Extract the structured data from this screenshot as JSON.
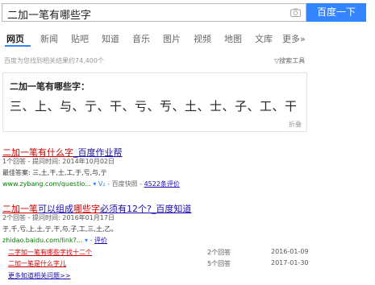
{
  "search": {
    "query": "二加一笔有哪些字",
    "button": "百度一下"
  },
  "tabs": [
    "网页",
    "新闻",
    "贴吧",
    "知道",
    "音乐",
    "图片",
    "视频",
    "地图",
    "文库",
    "更多»"
  ],
  "result_count": "百度为您找到相关结果约74,400个",
  "search_tools": "搜索工具",
  "card": {
    "title": "二加一笔有哪些字：",
    "chars": "三、上、与、亍、干、亏、亐、土、士、子、工、干",
    "collapse": "折叠"
  },
  "result1": {
    "title_hl": "二加一笔有什么字",
    "title_rest": "_百度作业帮",
    "meta": "1个回答 - 提问时间: 2014年10月02日",
    "best": "最佳答案: 三,土,干,士,工,于,亏,与,亍",
    "url": "www.zybang.com/questio...",
    "url_sep": "▾ V₂ -",
    "snapshot": "百度快照",
    "reviews": "4522条评价"
  },
  "result2": {
    "title_a": "二加一笔",
    "title_b": "可以组成",
    "title_c": "哪些字",
    "title_d": "必须有12个?_百度知道",
    "meta": "2个回答 - 提问时间: 2016年01月17日",
    "chars": "于,千,亏,上,土,亍,干,与,子,工,三,土,乙。",
    "url": "zhidao.baidu.com/link?...",
    "url_sep": "▾ -",
    "rate": "评价",
    "subs": [
      {
        "title": "二字加一笔有哪些字找十二个",
        "answers": "2个回答",
        "date": "2016-01-09"
      },
      {
        "title": "二加一笔是什么字儿",
        "answers": "5个回答",
        "date": "2017-01-30"
      }
    ],
    "more": "更多知道相关问题>>"
  }
}
